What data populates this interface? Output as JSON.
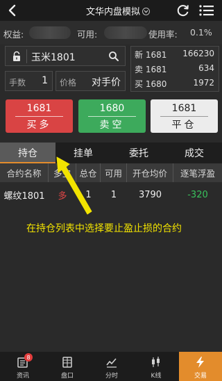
{
  "header": {
    "title": "文华内盘模拟"
  },
  "account": {
    "equity_label": "权益:",
    "available_label": "可用:",
    "usage_label": "使用率:",
    "usage_value": "0.1%"
  },
  "order_form": {
    "contract": "玉米1801",
    "qty_label": "手数",
    "qty_value": "1",
    "price_label": "价格",
    "price_value": "对手价"
  },
  "quote": {
    "rows": [
      {
        "label": "新 1681",
        "value": "166230"
      },
      {
        "label": "卖 1681",
        "value": "634"
      },
      {
        "label": "买 1680",
        "value": "1972"
      }
    ]
  },
  "trade_buttons": {
    "buy": {
      "price": "1681",
      "label": "买多"
    },
    "sell": {
      "price": "1680",
      "label": "卖空"
    },
    "close": {
      "price": "1681",
      "label": "平仓"
    }
  },
  "tabs": [
    {
      "label": "持仓",
      "active": true
    },
    {
      "label": "挂单",
      "active": false
    },
    {
      "label": "委托",
      "active": false
    },
    {
      "label": "成交",
      "active": false
    }
  ],
  "positions": {
    "columns": [
      "合约名称",
      "多空",
      "总仓",
      "可用",
      "开仓均价",
      "逐笔浮盈"
    ],
    "rows": [
      {
        "contract": "螺纹1801",
        "direction": "多",
        "total": "1",
        "available": "1",
        "avg_price": "3790",
        "pnl": "-320"
      }
    ]
  },
  "annotation": "在持仓列表中选择要止盈止损的合约",
  "bottom_nav": {
    "items": [
      {
        "label": "资讯",
        "icon": "news-icon",
        "badge": "8"
      },
      {
        "label": "盘口",
        "icon": "orderbook-icon"
      },
      {
        "label": "分时",
        "icon": "timeshare-icon"
      },
      {
        "label": "K线",
        "icon": "candlestick-icon"
      },
      {
        "label": "交易",
        "icon": "lightning-icon",
        "active": true
      }
    ]
  },
  "colors": {
    "buy": "#d94444",
    "sell": "#3daa5c",
    "accent": "#e38c2c",
    "annotation": "#f2e300"
  }
}
